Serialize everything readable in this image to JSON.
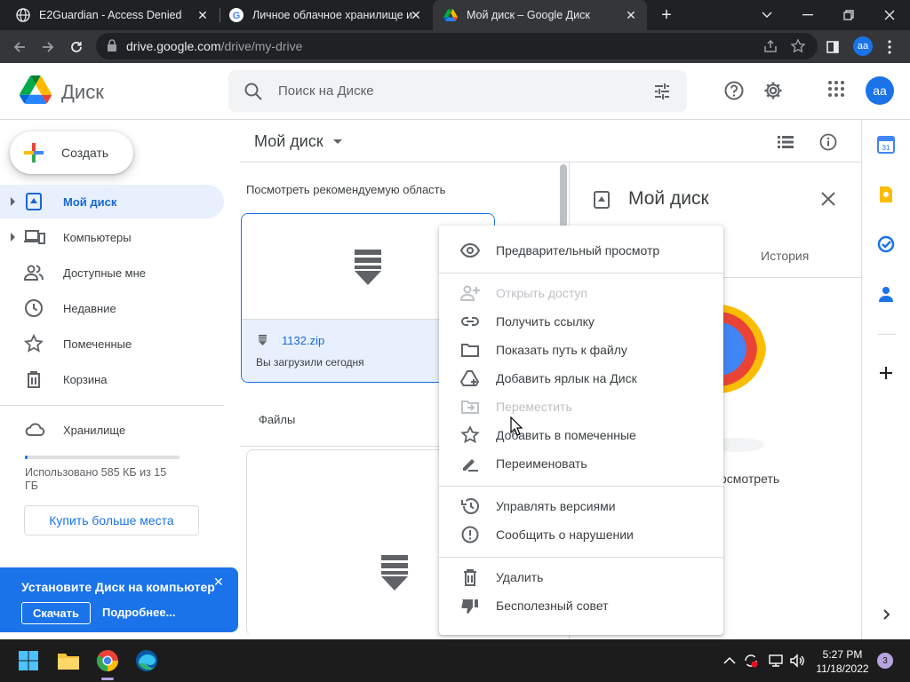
{
  "browser": {
    "tabs": [
      {
        "title": "E2Guardian - Access Denied",
        "favicon": "globe-icon",
        "active": false
      },
      {
        "title": "Личное облачное хранилище и",
        "favicon": "google-g-icon",
        "active": false
      },
      {
        "title": "Мой диск – Google Диск",
        "favicon": "google-drive-icon",
        "active": true
      }
    ],
    "new_tab": "+",
    "url_host": "drive.google.com",
    "url_path": "/drive/my-drive",
    "profile_initials": "aa"
  },
  "header": {
    "app_name": "Диск",
    "search_placeholder": "Поиск на Диске",
    "avatar_initials": "aa"
  },
  "sidebar": {
    "create_label": "Создать",
    "items": [
      {
        "label": "Мой диск",
        "icon": "my-drive-icon",
        "active": true,
        "expandable": true
      },
      {
        "label": "Компьютеры",
        "icon": "computers-icon",
        "active": false,
        "expandable": true
      },
      {
        "label": "Доступные мне",
        "icon": "shared-icon",
        "active": false,
        "expandable": false
      },
      {
        "label": "Недавние",
        "icon": "clock-icon",
        "active": false,
        "expandable": false
      },
      {
        "label": "Помеченные",
        "icon": "star-icon",
        "active": false,
        "expandable": false
      },
      {
        "label": "Корзина",
        "icon": "trash-icon",
        "active": false,
        "expandable": false
      }
    ],
    "storage_label": "Хранилище",
    "storage_used_text": "Использовано 585 КБ из 15 ГБ",
    "storage_fraction": 0.01,
    "buy_storage": "Купить больше места",
    "promo": {
      "title": "Установите Диск на компьютер",
      "download": "Скачать",
      "more": "Подробнее..."
    }
  },
  "main": {
    "title": "Мой диск",
    "suggested_label": "Посмотреть рекомендуемую область",
    "suggested_file": {
      "name": "1132.zip",
      "subtitle": "Вы загрузили сегодня"
    },
    "files_label": "Файлы"
  },
  "details": {
    "title": "Мой диск",
    "tab_history": "История",
    "hint_partial": "осмотреть"
  },
  "context_menu": {
    "items": [
      {
        "label": "Предварительный просмотр",
        "icon": "eye-icon",
        "disabled": false
      },
      {
        "label": "Открыть доступ",
        "icon": "person-add-icon",
        "disabled": true
      },
      {
        "label": "Получить ссылку",
        "icon": "link-icon",
        "disabled": false
      },
      {
        "label": "Показать путь к файлу",
        "icon": "folder-icon",
        "disabled": false
      },
      {
        "label": "Добавить ярлык на Диск",
        "icon": "drive-shortcut-icon",
        "disabled": false
      },
      {
        "label": "Переместить",
        "icon": "move-icon",
        "disabled": true
      },
      {
        "label": "Добавить в помеченные",
        "icon": "star-icon",
        "disabled": false
      },
      {
        "label": "Переименовать",
        "icon": "rename-icon",
        "disabled": false
      },
      {
        "label": "Управлять версиями",
        "icon": "history-icon",
        "disabled": false
      },
      {
        "label": "Сообщить о нарушении",
        "icon": "report-icon",
        "disabled": false
      },
      {
        "label": "Удалить",
        "icon": "trash-icon",
        "disabled": false
      },
      {
        "label": "Бесполезный совет",
        "icon": "thumb-down-icon",
        "disabled": false
      }
    ]
  },
  "side_panel": {
    "calendar_day": "31"
  },
  "taskbar": {
    "time": "5:27 PM",
    "date": "11/18/2022",
    "notifications": "3"
  },
  "colors": {
    "accent": "#1a73e8",
    "active_bg": "#e8f0fe",
    "chrome_dark": "#202124",
    "chrome_toolbar": "#35363a",
    "taskbar": "#1c1c1c"
  }
}
